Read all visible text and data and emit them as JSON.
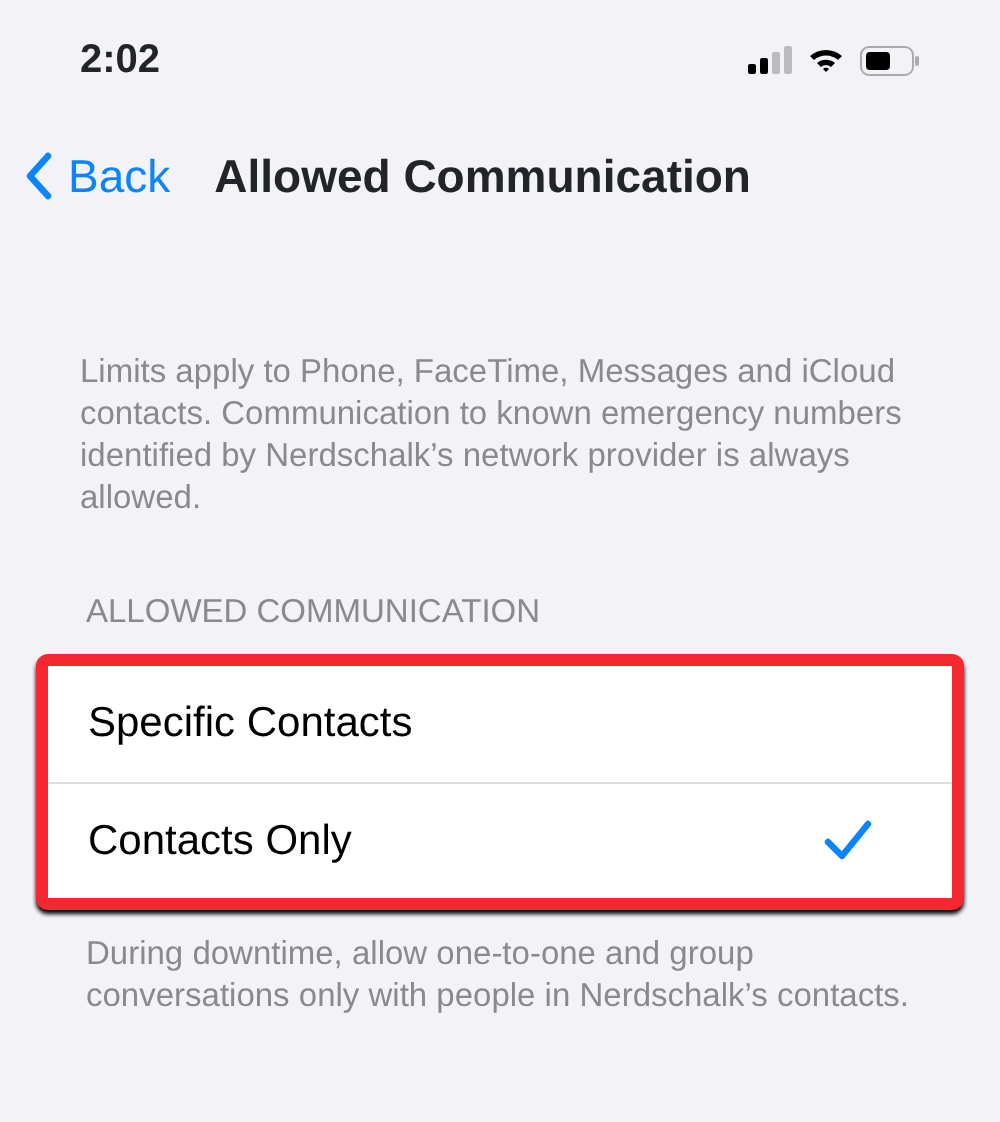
{
  "status_bar": {
    "time": "2:02"
  },
  "nav": {
    "back": "Back",
    "title": "Allowed Communication"
  },
  "description": "Limits apply to Phone, FaceTime, Messages and iCloud contacts. Communication to known emergency numbers identified by Nerdschalk’s network provider is always allowed.",
  "section": {
    "header": "ALLOWED COMMUNICATION",
    "highlighted": true,
    "options": [
      {
        "label": "Specific Contacts",
        "selected": false
      },
      {
        "label": "Contacts Only",
        "selected": true
      }
    ],
    "footer": "During downtime, allow one-to-one and group conversations only with people in Nerdschalk’s contacts."
  }
}
